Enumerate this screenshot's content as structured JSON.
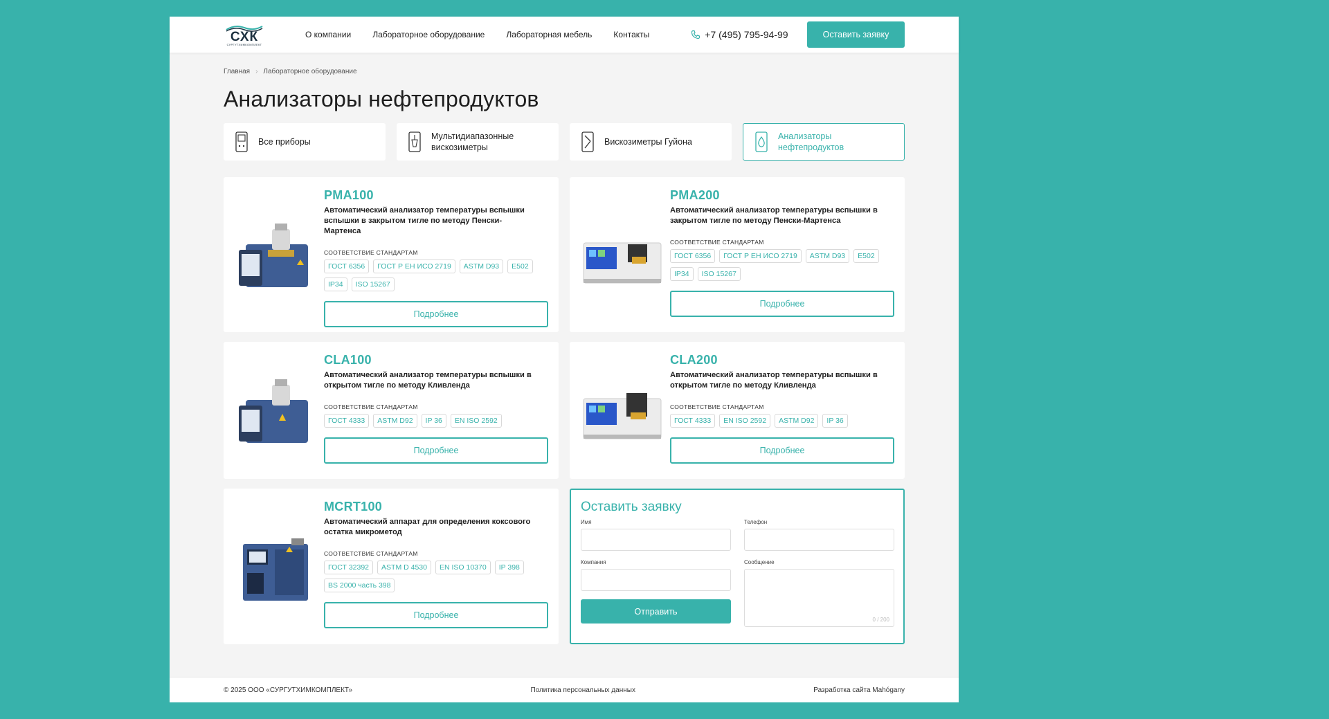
{
  "header": {
    "logo_text": "СХК",
    "logo_sub": "СУРГУТХИМКОМПЛЕКТ",
    "nav": [
      "О компании",
      "Лабораторное оборудование",
      "Лабораторная мебель",
      "Контакты"
    ],
    "phone": "+7 (495) 795-94-99",
    "cta": "Оставить заявку"
  },
  "breadcrumb": [
    "Главная",
    "Лабораторное оборудование"
  ],
  "title": "Анализаторы нефтепродуктов",
  "categories": [
    {
      "label": "Все приборы",
      "icon": "device-icon",
      "active": false
    },
    {
      "label": "Мультидиапазонные вискозиметры",
      "icon": "viscometer-icon",
      "active": false
    },
    {
      "label": "Вискозиметры Гуйона",
      "icon": "tube-icon",
      "active": false
    },
    {
      "label": "Анализаторы нефтепродуктов",
      "icon": "drop-icon",
      "active": true
    }
  ],
  "standards_label": "СООТВЕТСТВИЕ СТАНДАРТАМ",
  "more_label": "Подробнее",
  "products": [
    {
      "name": "PMA100",
      "desc": "Автоматический анализатор температуры вспышки вспышки в закрытом тигле по методу Пенски-Мартенса",
      "tags": [
        "ГОСТ 6356",
        "ГОСТ Р ЕН ИСО 2719",
        "ASTM D93",
        "E502",
        "IP34",
        "ISO 15267"
      ]
    },
    {
      "name": "PMA200",
      "desc": "Автоматический анализатор температуры вспышки в закрытом тигле по методу Пенски-Мартенса",
      "tags": [
        "ГОСТ 6356",
        "ГОСТ Р ЕН ИСО 2719",
        "ASTM D93",
        "E502",
        "IP34",
        "ISO 15267"
      ]
    },
    {
      "name": "CLA100",
      "desc": "Автоматический анализатор температуры вспышки в открытом тигле по методу Кливленда",
      "tags": [
        "ГОСТ 4333",
        "ASTM D92",
        "IP 36",
        "EN ISO 2592"
      ]
    },
    {
      "name": "CLA200",
      "desc": "Автоматический анализатор температуры вспышки в открытом тигле по методу Кливленда",
      "tags": [
        "ГОСТ 4333",
        "EN ISO 2592",
        "ASTM D92",
        "IP 36"
      ]
    },
    {
      "name": "MCRT100",
      "desc": "Автоматический аппарат для определения коксового остатка микрометод",
      "tags": [
        "ГОСТ 32392",
        "ASTM D 4530",
        "EN ISO 10370",
        "IP 398",
        "BS 2000 часть 398"
      ]
    }
  ],
  "form": {
    "title": "Оставить заявку",
    "name_label": "Имя",
    "phone_label": "Телефон",
    "company_label": "Компания",
    "message_label": "Сообщение",
    "submit": "Отправить",
    "counter": "0 / 200"
  },
  "footer": {
    "copyright": "© 2025 ООО «СУРГУТХИМКОМПЛЕКТ»",
    "policy": "Политика персональных данных",
    "dev": "Разработка сайта Mahógany"
  },
  "colors": {
    "accent": "#38b2ab",
    "background": "#38b2ab",
    "page": "#f4f4f4"
  }
}
